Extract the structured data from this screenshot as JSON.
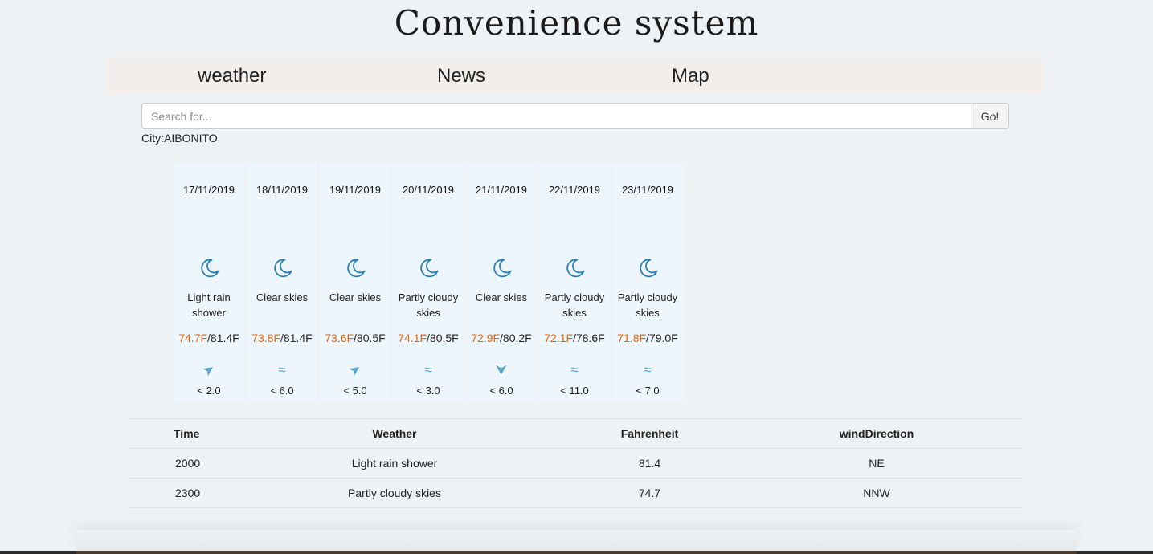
{
  "header": {
    "title": "Convenience system"
  },
  "nav": [
    {
      "label": "weather"
    },
    {
      "label": "News"
    },
    {
      "label": "Map"
    }
  ],
  "search": {
    "placeholder": "Search for...",
    "value": "",
    "button_label": "Go!"
  },
  "city": {
    "label": "City:AIBONITO"
  },
  "forecast": [
    {
      "date": "17/11/2019",
      "icon": "moon-icon",
      "condition": "Light rain shower",
      "temp_low": "74.7F",
      "temp_high": "/81.4F",
      "wind_icon": "arrow-up-right-icon",
      "wind": "< 2.0"
    },
    {
      "date": "18/11/2019",
      "icon": "moon-icon",
      "condition": "Clear skies",
      "temp_low": "73.8F",
      "temp_high": "/81.4F",
      "wind_icon": "wind-waves-icon",
      "wind": "< 6.0"
    },
    {
      "date": "19/11/2019",
      "icon": "moon-icon",
      "condition": "Clear skies",
      "temp_low": "73.6F",
      "temp_high": "/80.5F",
      "wind_icon": "arrow-up-right-icon",
      "wind": "< 5.0"
    },
    {
      "date": "20/11/2019",
      "icon": "moon-icon",
      "condition": "Partly cloudy skies",
      "temp_low": "74.1F",
      "temp_high": "/80.5F",
      "wind_icon": "wind-waves-icon",
      "wind": "< 3.0"
    },
    {
      "date": "21/11/2019",
      "icon": "moon-icon",
      "condition": "Clear skies",
      "temp_low": "72.9F",
      "temp_high": "/80.2F",
      "wind_icon": "arrow-down-icon",
      "wind": "< 6.0"
    },
    {
      "date": "22/11/2019",
      "icon": "moon-icon",
      "condition": "Partly cloudy skies",
      "temp_low": "72.1F",
      "temp_high": "/78.6F",
      "wind_icon": "wind-waves-icon",
      "wind": "< 11.0"
    },
    {
      "date": "23/11/2019",
      "icon": "moon-icon",
      "condition": "Partly cloudy skies",
      "temp_low": "71.8F",
      "temp_high": "/79.0F",
      "wind_icon": "wind-waves-icon",
      "wind": "< 7.0"
    }
  ],
  "hourly": {
    "headers": [
      "Time",
      "Weather",
      "Fahrenheit",
      "windDirection"
    ],
    "rows": [
      [
        "2000",
        "Light rain shower",
        "81.4",
        "NE"
      ],
      [
        "2300",
        "Partly cloudy skies",
        "74.7",
        "NNW"
      ]
    ]
  },
  "colors": {
    "low_temp": "#e0650f",
    "icon_blue": "#2a7fb0",
    "wind_blue": "#5aa2c8",
    "card_bg": "#eef6fd",
    "nav_bg": "#f1eeec",
    "page_bg": "#eef2f5"
  }
}
